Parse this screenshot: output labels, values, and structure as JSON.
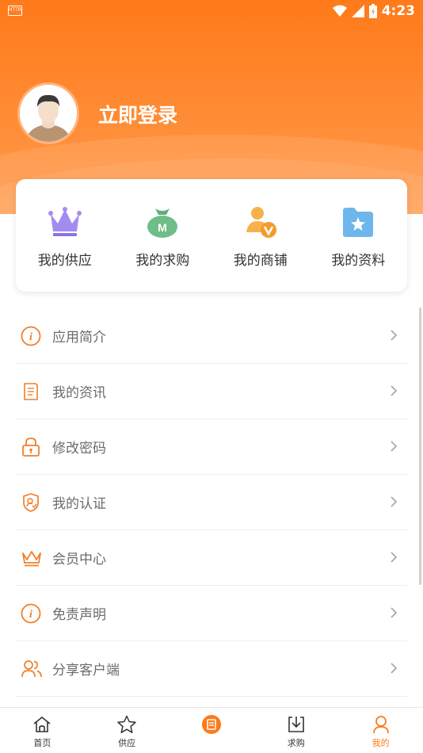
{
  "status": {
    "time": "4:23",
    "left_icon_text": "HTTR"
  },
  "profile": {
    "login_label": "立即登录"
  },
  "quick": [
    {
      "label": "我的供应",
      "icon": "crown-icon"
    },
    {
      "label": "我的求购",
      "icon": "money-bag-icon"
    },
    {
      "label": "我的商铺",
      "icon": "verified-user-icon"
    },
    {
      "label": "我的资料",
      "icon": "star-folder-icon"
    }
  ],
  "menu": [
    {
      "label": "应用简介",
      "icon": "info-icon"
    },
    {
      "label": "我的资讯",
      "icon": "document-icon"
    },
    {
      "label": "修改密码",
      "icon": "lock-icon"
    },
    {
      "label": "我的认证",
      "icon": "shield-user-icon"
    },
    {
      "label": "会员中心",
      "icon": "crown-outline-icon"
    },
    {
      "label": "免责声明",
      "icon": "info-icon"
    },
    {
      "label": "分享客户端",
      "icon": "users-icon"
    }
  ],
  "tabs": [
    {
      "label": "首页",
      "icon": "home-icon"
    },
    {
      "label": "供应",
      "icon": "star-icon"
    },
    {
      "label": "",
      "icon": "center-news-icon"
    },
    {
      "label": "求购",
      "icon": "download-icon"
    },
    {
      "label": "我的",
      "icon": "person-icon"
    }
  ],
  "colors": {
    "accent": "#ff7a1a",
    "icon_orange": "#f07f2a",
    "text_gray": "#6b6b6b"
  }
}
